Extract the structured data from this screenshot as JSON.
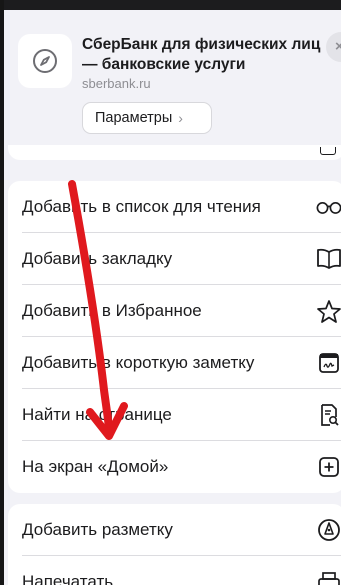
{
  "site": {
    "title": "СберБанк для физических лиц — банковские услуги",
    "url": "sberbank.ru",
    "params_label": "Параметры",
    "params_chevron": "›",
    "close_label": "×"
  },
  "menu_group_1": [
    {
      "label": "Добавить в список для чтения",
      "icon": "reading-list-glasses-icon"
    },
    {
      "label": "Добавить закладку",
      "icon": "book-icon"
    },
    {
      "label": "Добавить в Избранное",
      "icon": "star-icon"
    },
    {
      "label": "Добавить в короткую заметку",
      "icon": "quick-note-icon"
    },
    {
      "label": "Найти на странице",
      "icon": "find-on-page-icon"
    },
    {
      "label": "На экран «Домой»",
      "icon": "add-square-icon"
    }
  ],
  "menu_group_2": [
    {
      "label": "Добавить разметку",
      "icon": "markup-pen-icon"
    },
    {
      "label": "Напечатать",
      "icon": "printer-icon"
    }
  ],
  "colors": {
    "annotation_arrow": "#e0191e",
    "background": "#f2f2f7"
  }
}
